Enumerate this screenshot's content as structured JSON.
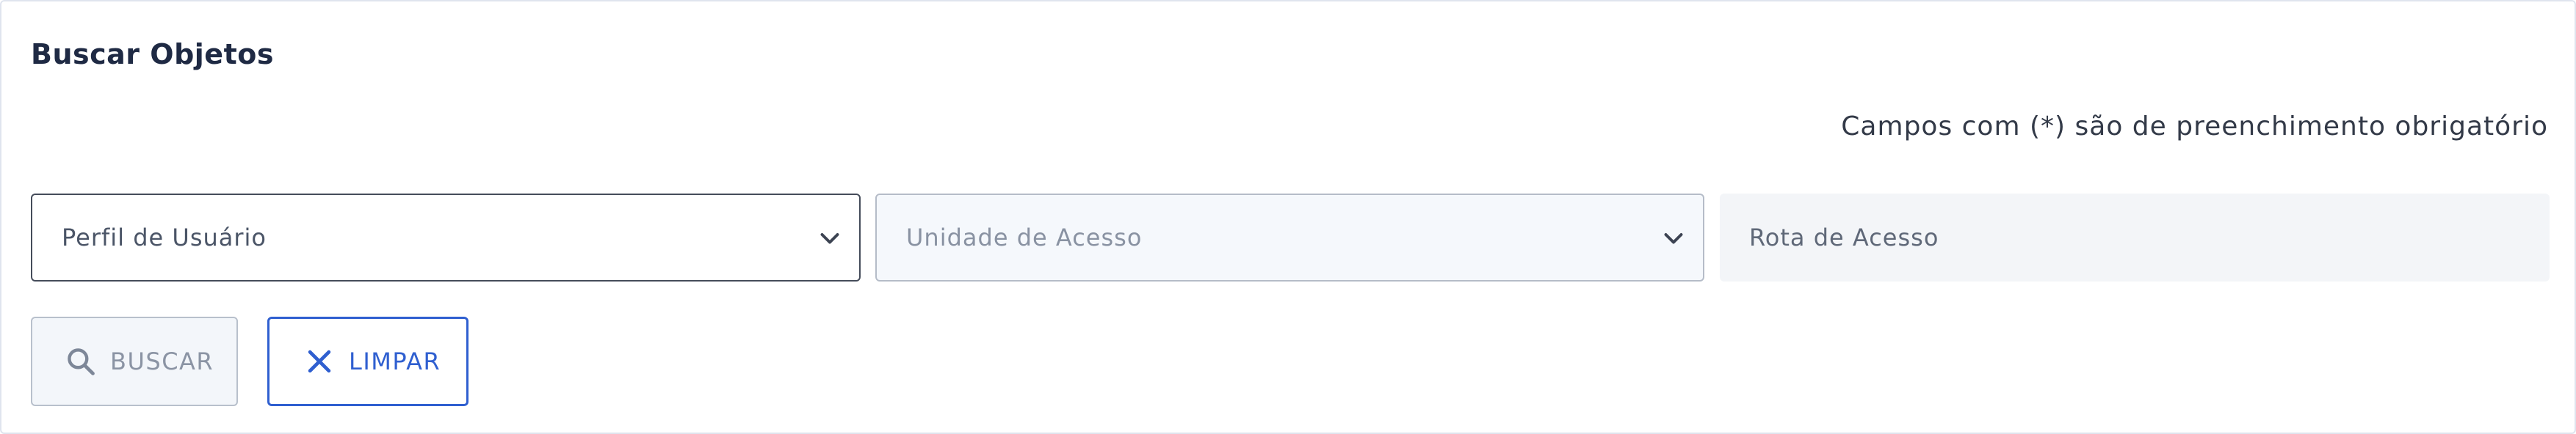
{
  "panel": {
    "title": "Buscar Objetos",
    "required_note": "Campos com (*) são de preenchimento obrigatório"
  },
  "fields": {
    "user_profile": {
      "placeholder": "Perfil de Usuário",
      "icon": "chevron-down-icon"
    },
    "access_unit": {
      "placeholder": "Unidade de Acesso",
      "icon": "chevron-down-icon"
    },
    "access_route": {
      "placeholder": "Rota de Acesso"
    }
  },
  "buttons": {
    "search": {
      "label": "BUSCAR",
      "icon": "search-icon"
    },
    "clear": {
      "label": "LIMPAR",
      "icon": "close-icon"
    }
  },
  "colors": {
    "accent": "#2f5fd0",
    "title": "#1f2a44",
    "border_dark": "#454c5a",
    "disabled_bg": "#f5f8fc"
  }
}
